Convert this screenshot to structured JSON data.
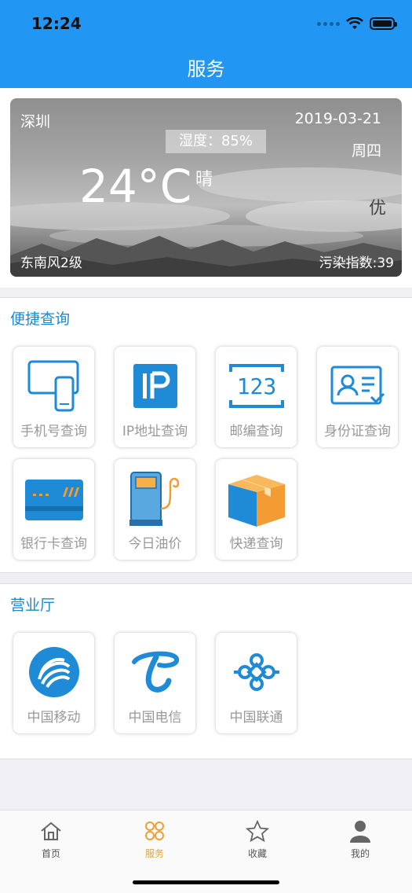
{
  "status": {
    "time": "12:24"
  },
  "header": {
    "title": "服务"
  },
  "weather": {
    "city": "深圳",
    "date": "2019-03-21",
    "humidity": "湿度：85%",
    "weekday": "周四",
    "temperature": "24°C",
    "condition": "晴",
    "aqi_level": "优",
    "wind": "东南风2级",
    "pollution": "污染指数:39"
  },
  "quick_query": {
    "title": "便捷查询",
    "items": [
      {
        "label": "手机号查询",
        "icon": "phone-tablet-icon"
      },
      {
        "label": "IP地址查询",
        "icon": "ip-icon"
      },
      {
        "label": "邮编查询",
        "icon": "postcode-123-icon"
      },
      {
        "label": "身份证查询",
        "icon": "id-card-icon"
      },
      {
        "label": "银行卡查询",
        "icon": "bank-card-icon"
      },
      {
        "label": "今日油价",
        "icon": "fuel-pump-icon"
      },
      {
        "label": "快递查询",
        "icon": "package-box-icon"
      }
    ]
  },
  "business_hall": {
    "title": "营业厅",
    "items": [
      {
        "label": "中国移动",
        "icon": "china-mobile-logo"
      },
      {
        "label": "中国电信",
        "icon": "china-telecom-logo"
      },
      {
        "label": "中国联通",
        "icon": "china-unicom-logo"
      }
    ]
  },
  "tabs": [
    {
      "label": "首页",
      "icon": "home-icon"
    },
    {
      "label": "服务",
      "icon": "service-icon",
      "active": true
    },
    {
      "label": "收藏",
      "icon": "star-icon"
    },
    {
      "label": "我的",
      "icon": "profile-icon"
    }
  ],
  "colors": {
    "accent": "#2196f3",
    "section_title": "#1e88c8",
    "active_tab": "#f0a030",
    "icon_blue": "#1f8ad6",
    "icon_orange": "#f39c33"
  }
}
